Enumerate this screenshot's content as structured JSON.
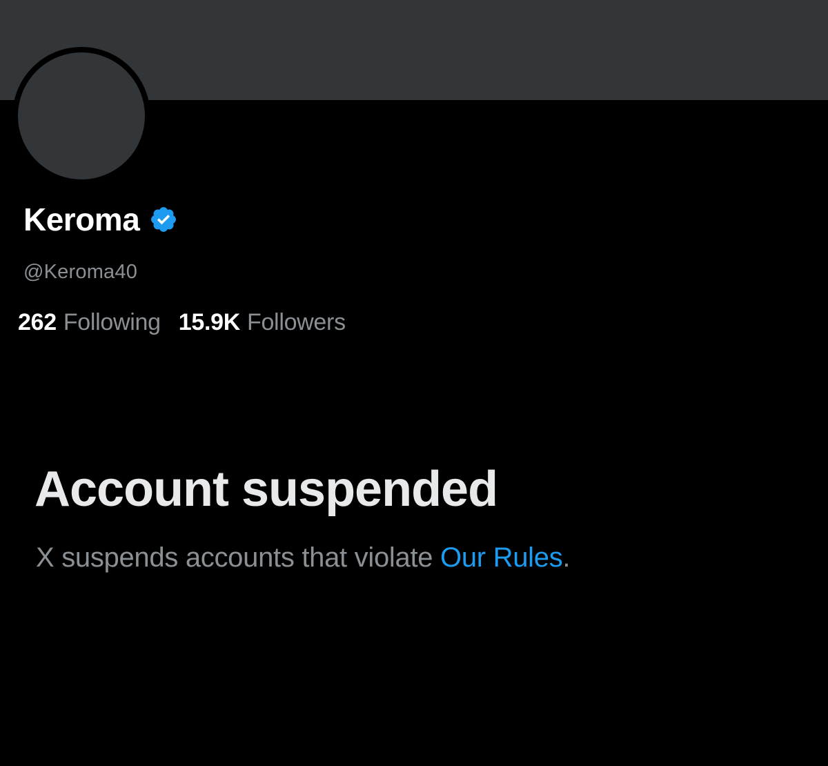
{
  "profile": {
    "display_name": "Keroma",
    "handle": "@Keroma40",
    "verified_icon": "verified-badge-icon",
    "following_count": "262",
    "following_label": "Following",
    "followers_count": "15.9K",
    "followers_label": "Followers"
  },
  "suspension": {
    "title": "Account suspended",
    "message_prefix": "X suspends accounts that violate ",
    "rules_link": "Our Rules",
    "message_suffix": "."
  },
  "colors": {
    "background": "#000000",
    "banner": "#333639",
    "accent": "#1d9bf0",
    "secondary_text": "#8b9095",
    "primary_text": "#e7e9ea"
  }
}
